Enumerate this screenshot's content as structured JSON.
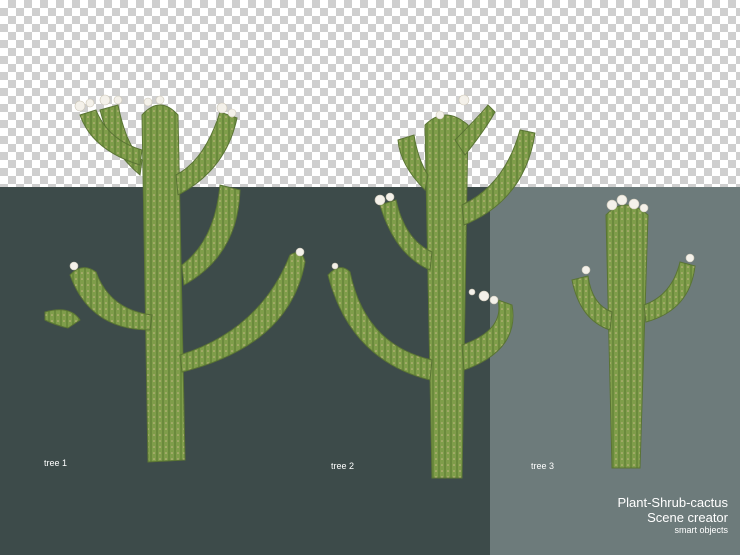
{
  "labels": {
    "tree1": "tree 1",
    "tree2": "tree 2",
    "tree3": "tree 3"
  },
  "caption": {
    "title": "Plant-Shrub-cactus",
    "subtitle": "Scene creator",
    "tagline": "smart objects"
  },
  "colors": {
    "dark_panel": "#3d4b4a",
    "light_panel": "#6d7b7b",
    "cactus": "#7a9a48",
    "cactus_dark": "#5e7a38",
    "flower": "#f4f1ea"
  }
}
